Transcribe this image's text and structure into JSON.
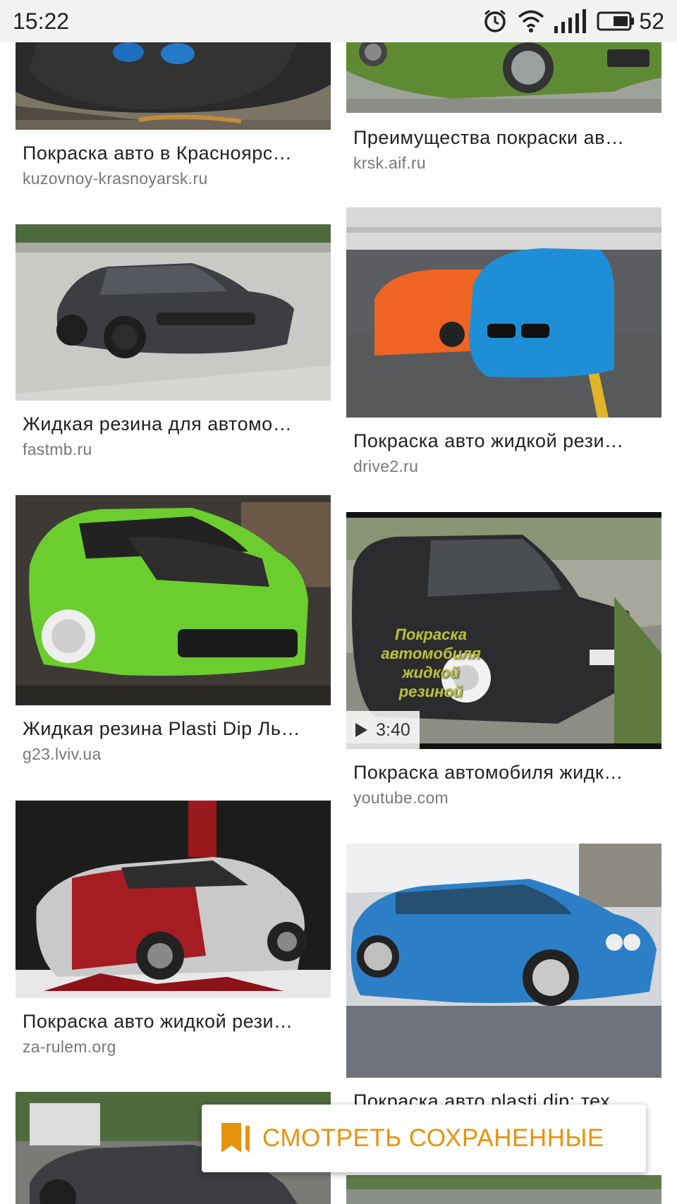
{
  "status_bar": {
    "time": "15:22",
    "battery": "52"
  },
  "results": [
    {
      "title": "Покраска авто в Красноярс…",
      "source": "kuzovnoy-krasnoyarsk.ru"
    },
    {
      "title": "Преимущества покраски ав…",
      "source": "krsk.aif.ru"
    },
    {
      "title": "Жидкая резина для автомо…",
      "source": "fastmb.ru"
    },
    {
      "title": "Покраска авто жидкой рези…",
      "source": "drive2.ru"
    },
    {
      "title": "Жидкая резина Plasti Dip Ль…",
      "source": "g23.lviv.ua"
    },
    {
      "title": "Покраска автомобиля жидк…",
      "source": "youtube.com",
      "duration": "3:40",
      "overlay_text": [
        "Покраска",
        "автомобиля",
        "жидкой",
        "резиной"
      ]
    },
    {
      "title": "Покраска авто жидкой рези…",
      "source": "za-rulem.org"
    },
    {
      "title": "Покраска авто plasti dip: тех…",
      "source": ""
    }
  ],
  "saved_button": {
    "label": "СМОТРЕТЬ СОХРАНЕННЫЕ",
    "icon": "bookmark-icon"
  },
  "colors": {
    "accent": "#e8930c",
    "source_text": "#777777",
    "title_text": "#202124"
  }
}
